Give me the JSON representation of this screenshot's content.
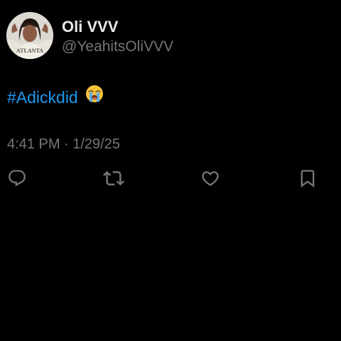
{
  "tweet": {
    "author": {
      "display_name": "Oli VVV",
      "handle": "@YeahitsOliVVV",
      "avatar_icon": "profile-photo",
      "avatar_shirt_text": "ATLANTA"
    },
    "text": {
      "hashtag": "#Adickdid",
      "emoji": "loudly-crying-face"
    },
    "timestamp": "4:41 PM · 1/29/25",
    "actions": {
      "reply_icon": "reply-icon",
      "retweet_icon": "retweet-icon",
      "like_icon": "heart-icon",
      "bookmark_icon": "bookmark-icon"
    }
  },
  "colors": {
    "background": "#000000",
    "primary_text": "#e7e9ea",
    "secondary_text": "#71767b",
    "link": "#1d9bf0"
  }
}
